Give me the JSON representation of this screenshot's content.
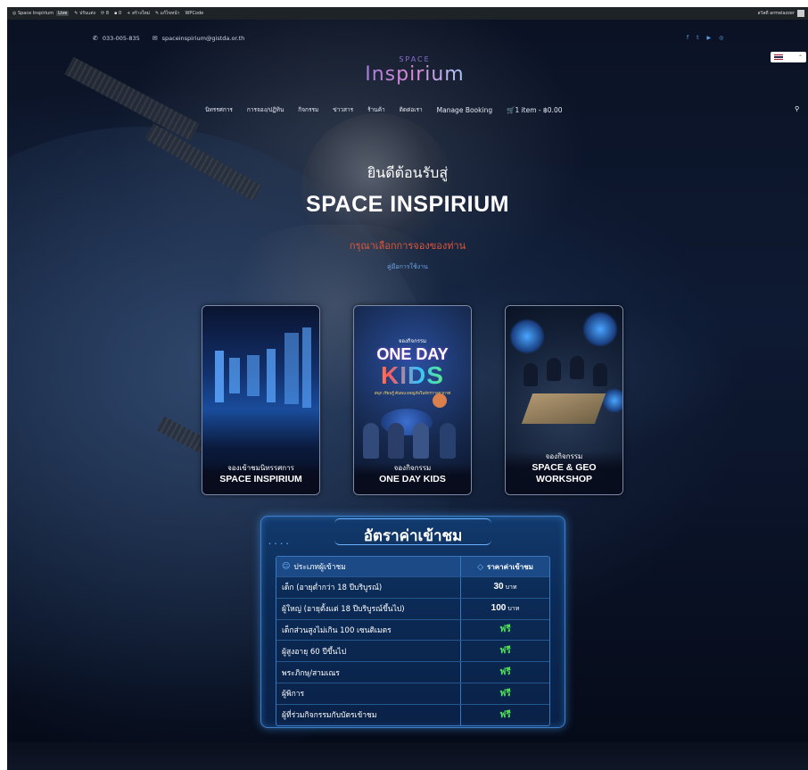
{
  "admin_bar": {
    "site_name": "Space Inspirium",
    "live_badge": "Live",
    "items": [
      "ปรับแต่ง",
      "8",
      "0",
      "สร้างใหม่",
      "แก้ไขหน้า",
      "WPCode"
    ],
    "user": "สวัสดี armelazzer"
  },
  "contact": {
    "phone": "033-005-835",
    "email": "spaceinspirium@gistda.or.th"
  },
  "social": [
    "f",
    "t",
    "y",
    "ig"
  ],
  "language": {
    "flag": "th-flag"
  },
  "logo": {
    "small": "SPACE",
    "big": "Inspirium"
  },
  "nav": {
    "items": [
      "นิทรรศการ",
      "การจอง/ปฏิทิน",
      "กิจกรรม",
      "ข่าวสาร",
      "ร้านค้า",
      "ติดต่อเรา",
      "Manage Booking"
    ],
    "cart": "1 item - ฿0.00"
  },
  "hero": {
    "welcome": "ยินดีต้อนรับสู่",
    "title": "SPACE INSPIRIUM",
    "subtitle": "กรุณาเลือกการจองของท่าน",
    "manual": "คู่มือการใช้งาน"
  },
  "cards": [
    {
      "line1": "จองเข้าชมนิทรรศการ",
      "line2": "SPACE INSPIRIUM"
    },
    {
      "line1": "จองกิจกรรม",
      "line2": "ONE DAY KIDS",
      "poster": {
        "top": "จองกิจกรรม",
        "one_day": "ONE DAY",
        "kids": "KIDS",
        "tagline": "สนุก เรียนรู้ ค้นพบ ผจญภัยในจักรวาลอวกาศ"
      }
    },
    {
      "line1": "จองกิจกรรม",
      "line2": "SPACE & GEO",
      "line3": "WORKSHOP"
    }
  ],
  "pricing": {
    "title": "อัตราค่าเข้าชม",
    "col_type": "ประเภทผู้เข้าชม",
    "col_price": "ราคาค่าเข้าชม",
    "rows": [
      {
        "type": "เด็ก (อายุต่ำกว่า 18 ปีบริบูรณ์)",
        "price": "30",
        "unit": "บาท"
      },
      {
        "type": "ผู้ใหญ่ (อายุตั้งแต่ 18 ปีบริบูรณ์ขึ้นไป)",
        "price": "100",
        "unit": "บาท"
      },
      {
        "type": "เด็กส่วนสูงไม่เกิน 100 เซนติเมตร",
        "price": "ฟรี"
      },
      {
        "type": "ผู้สูงอายุ 60 ปีขึ้นไป",
        "price": "ฟรี"
      },
      {
        "type": "พระภิกษุ/สามเณร",
        "price": "ฟรี"
      },
      {
        "type": "ผู้พิการ",
        "price": "ฟรี"
      },
      {
        "type": "ผู้ที่ร่วมกิจกรรมกับบัตรเข้าชม",
        "price": "ฟรี"
      }
    ]
  },
  "colors": {
    "accent_red": "#e0573a",
    "free_green": "#4fe05a",
    "link_blue": "#6aa3e8"
  }
}
